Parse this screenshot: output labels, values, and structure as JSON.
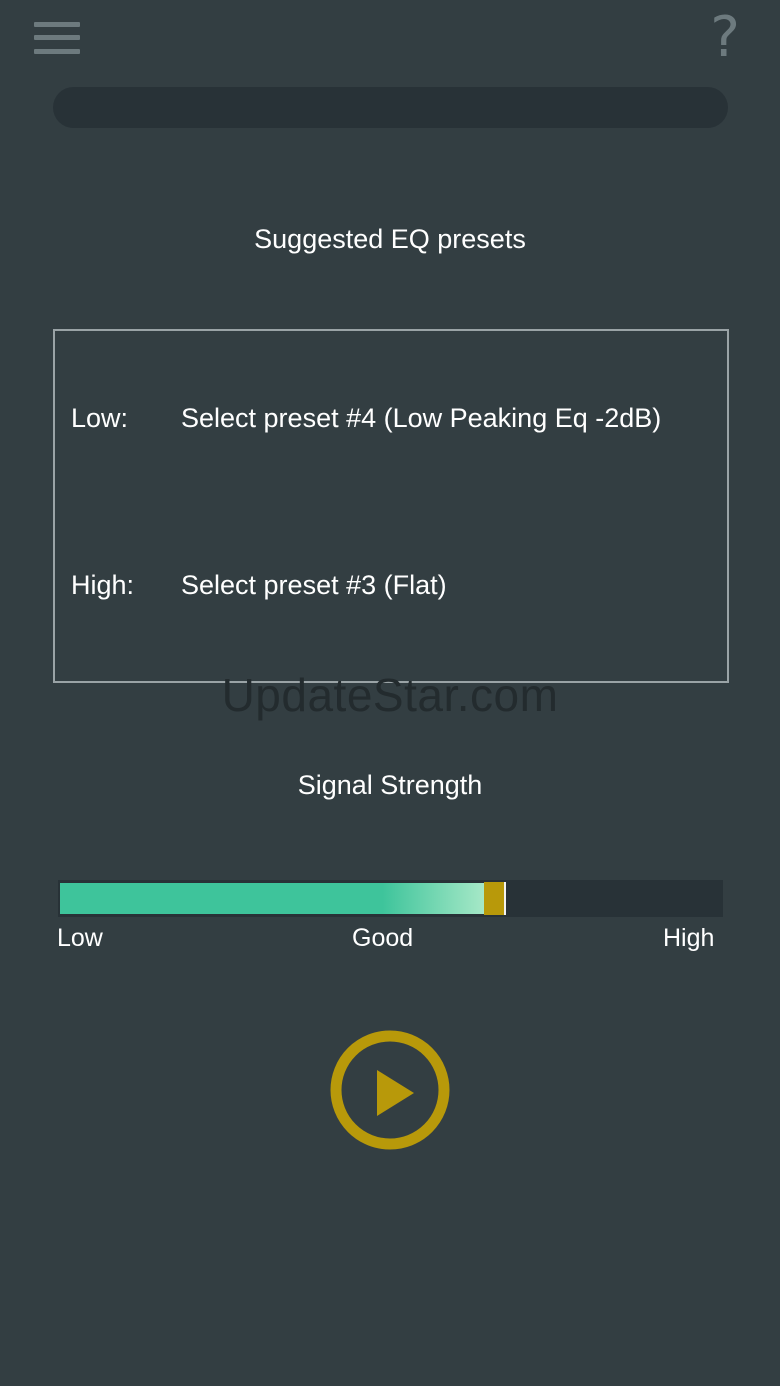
{
  "header": {
    "menu_icon": "hamburger-menu-icon",
    "help_icon": "question-mark-icon",
    "help_glyph": "?"
  },
  "presets": {
    "title": "Suggested EQ presets",
    "rows": [
      {
        "key": "Low:",
        "value": "Select preset #4 (Low Peaking Eq -2dB)"
      },
      {
        "key": "High:",
        "value": "Select preset #3 (Flat)"
      }
    ]
  },
  "watermark": "UpdateStar.com",
  "signal": {
    "title": "Signal Strength",
    "level_percent": 67,
    "labels": {
      "low": "Low",
      "good": "Good",
      "high": "High"
    }
  },
  "player": {
    "play_icon": "play-icon"
  },
  "colors": {
    "background": "#333e42",
    "accent": "#b8990a",
    "meter_fill": "#3ec49b",
    "track": "#283237"
  }
}
